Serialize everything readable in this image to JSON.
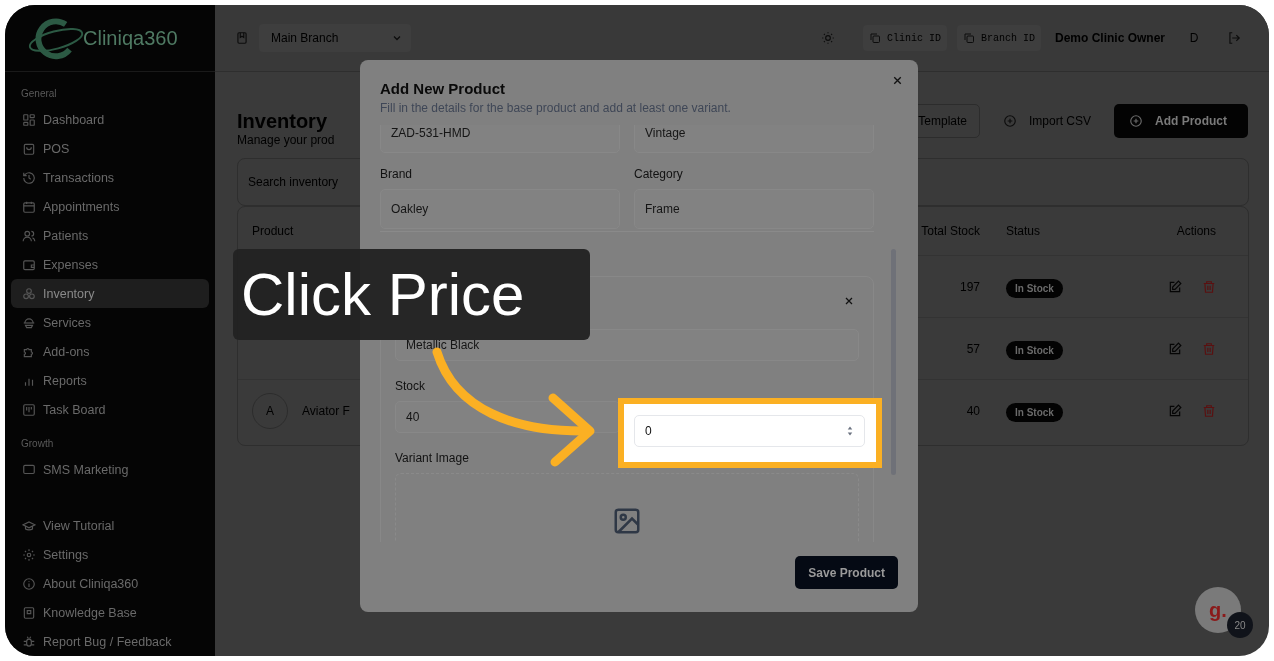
{
  "sidebar": {
    "logo_text": "Cliniqa360",
    "sections": [
      {
        "heading": "General",
        "items": [
          {
            "label": "Dashboard",
            "selected": false
          },
          {
            "label": "POS",
            "selected": false
          },
          {
            "label": "Transactions",
            "selected": false
          },
          {
            "label": "Appointments",
            "selected": false
          },
          {
            "label": "Patients",
            "selected": false
          },
          {
            "label": "Expenses",
            "selected": false
          },
          {
            "label": "Inventory",
            "selected": true
          },
          {
            "label": "Services",
            "selected": false
          },
          {
            "label": "Add-ons",
            "selected": false
          },
          {
            "label": "Reports",
            "selected": false
          },
          {
            "label": "Task Board",
            "selected": false
          }
        ]
      },
      {
        "heading": "Growth",
        "items": [
          {
            "label": "SMS Marketing",
            "selected": false
          }
        ]
      }
    ],
    "footer_items": [
      {
        "label": "View Tutorial"
      },
      {
        "label": "Settings"
      },
      {
        "label": "About Cliniqa360"
      },
      {
        "label": "Knowledge Base"
      },
      {
        "label": "Report Bug / Feedback"
      }
    ]
  },
  "topbar": {
    "branch": "Main Branch",
    "clinic_id": "Clinic ID",
    "branch_id": "Branch ID",
    "user": "Demo Clinic Owner",
    "avatar": "D"
  },
  "page": {
    "title": "Inventory",
    "subtitle": "Manage your prod",
    "buttons": [
      {
        "label": "Template",
        "kind": "outline"
      },
      {
        "label": "Import CSV",
        "kind": "ghost"
      },
      {
        "label": "Add Product",
        "kind": "primary"
      }
    ],
    "search": {
      "placeholder": "Search inventory"
    },
    "table": {
      "columns": [
        "Product",
        "Total Stock",
        "Status",
        "Actions"
      ],
      "rows": [
        {
          "total": "197",
          "status": "In Stock"
        },
        {
          "total": "57",
          "status": "In Stock"
        },
        {
          "avatar": "A",
          "product": "Aviator F",
          "total": "40",
          "status": "In Stock"
        }
      ]
    }
  },
  "modal": {
    "title": "Add New Product",
    "subtitle": "Fill in the details for the base product and add at least one variant.",
    "fields": [
      {
        "value": "ZAD-531-HMD"
      },
      {
        "value": "Vintage"
      },
      {
        "label": "Brand",
        "value": "Oakley"
      },
      {
        "label": "Category",
        "value": "Frame"
      }
    ],
    "variant": {
      "name_value": "Metallic Black",
      "stock_label": "Stock",
      "stock_value": "40",
      "price_value": "0",
      "image_label": "Variant Image"
    },
    "save_button": "Save Product"
  },
  "tooltip": {
    "text": "Click Price"
  },
  "chat_widget": {
    "logo": "g.",
    "badge": "20"
  }
}
